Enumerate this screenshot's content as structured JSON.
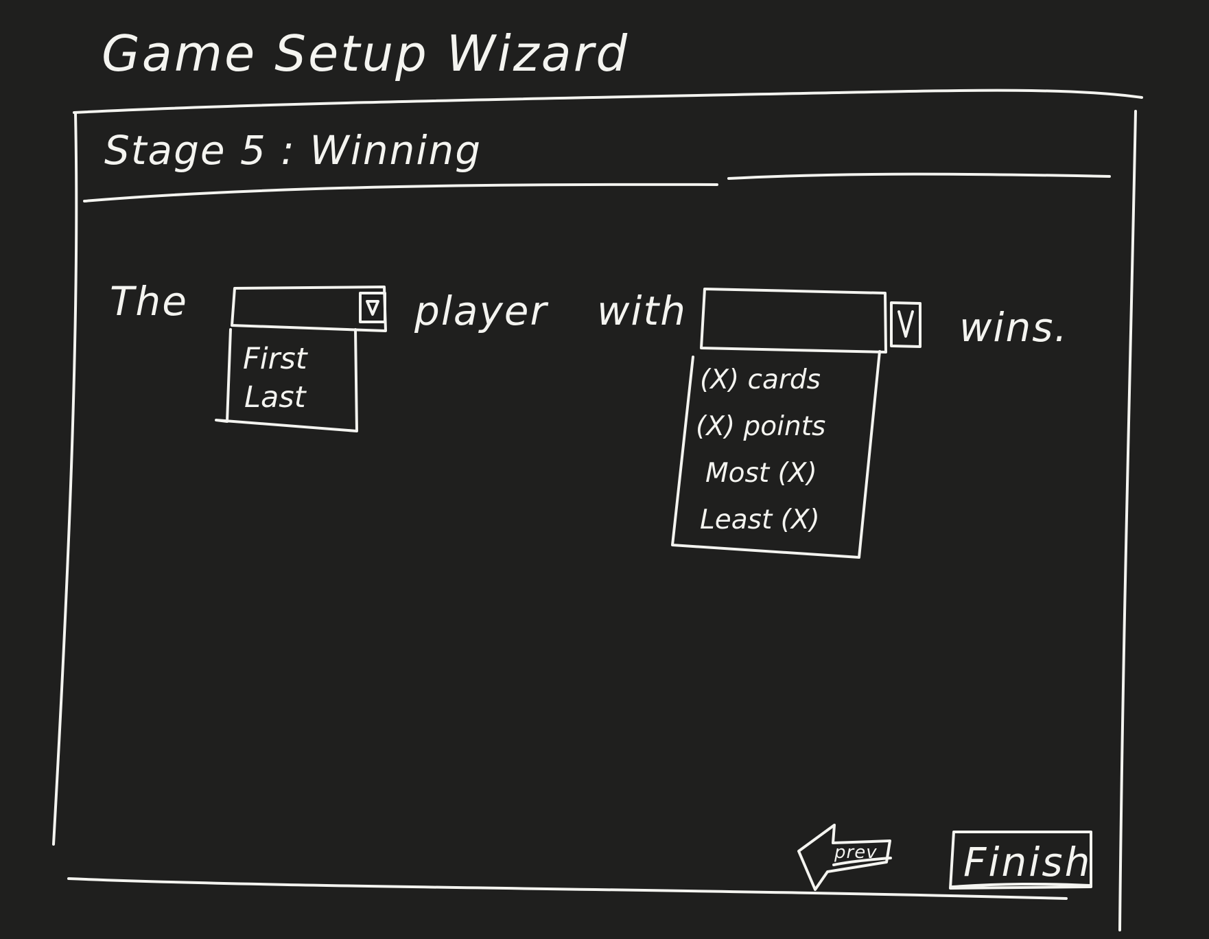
{
  "app": {
    "title": "Game Setup Wizard"
  },
  "wizard": {
    "stage_title": "Stage 5 : Winning",
    "sentence": {
      "prefix": "The",
      "middle_1": "player",
      "middle_2": "with",
      "suffix": "wins."
    },
    "position_select": {
      "value": "",
      "options": [
        "First",
        "Last"
      ]
    },
    "condition_select": {
      "value": "",
      "options": [
        "(X) cards",
        "(X) points",
        "Most (X)",
        "Least (X)"
      ]
    },
    "buttons": {
      "prev": "prev",
      "finish": "Finish"
    }
  },
  "colors": {
    "background": "#1f1f1e",
    "stroke": "#f4f4f0"
  },
  "icons": {
    "dropdown": "chevron-down-icon",
    "back": "arrow-left-icon"
  }
}
